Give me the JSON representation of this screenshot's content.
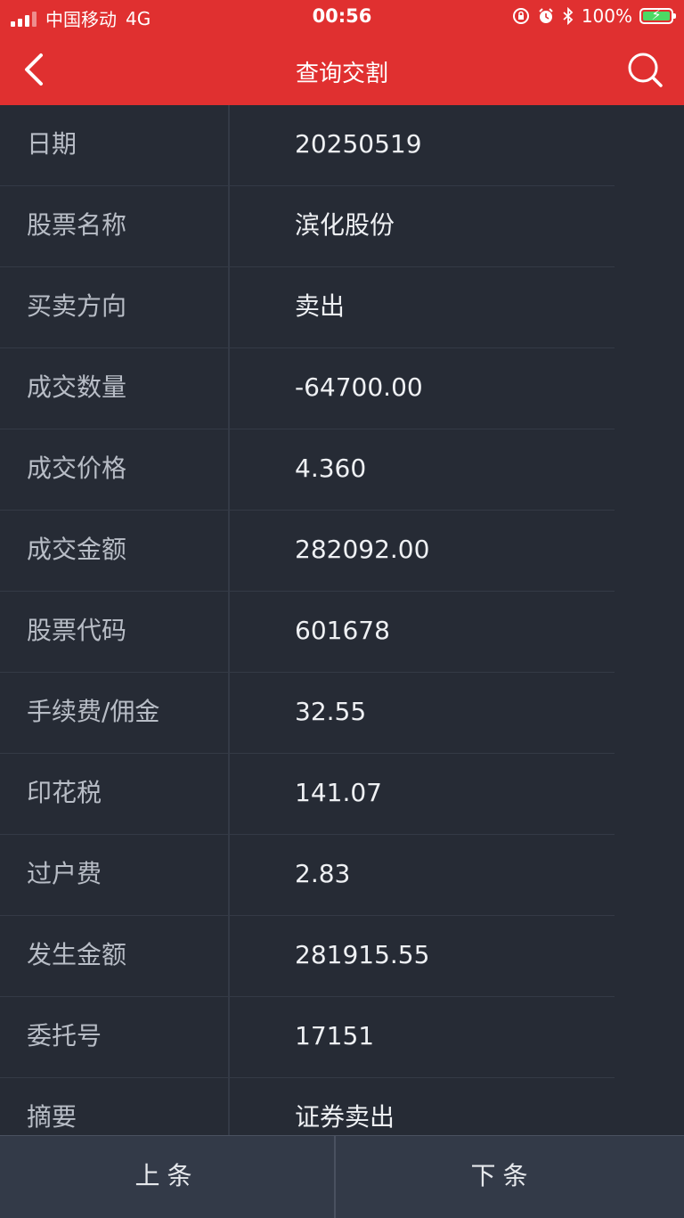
{
  "status_bar": {
    "carrier": "中国移动",
    "network": "4G",
    "time": "00:56",
    "battery": "100%"
  },
  "nav": {
    "title": "查询交割"
  },
  "rows": [
    {
      "label": "日期",
      "value": "20250519"
    },
    {
      "label": "股票名称",
      "value": "滨化股份"
    },
    {
      "label": "买卖方向",
      "value": "卖出"
    },
    {
      "label": "成交数量",
      "value": "-64700.00"
    },
    {
      "label": "成交价格",
      "value": "4.360"
    },
    {
      "label": "成交金额",
      "value": "282092.00"
    },
    {
      "label": "股票代码",
      "value": "601678"
    },
    {
      "label": "手续费/佣金",
      "value": "32.55"
    },
    {
      "label": "印花税",
      "value": "141.07"
    },
    {
      "label": "过户费",
      "value": "2.83"
    },
    {
      "label": "发生金额",
      "value": "281915.55"
    },
    {
      "label": "委托号",
      "value": "17151"
    },
    {
      "label": "摘要",
      "value": "证券卖出"
    }
  ],
  "bottom": {
    "prev_label": "上条",
    "next_label": "下条"
  },
  "colors": {
    "header_red": "#e03030",
    "background": "#262b35",
    "bottom_bar": "#333a48"
  }
}
